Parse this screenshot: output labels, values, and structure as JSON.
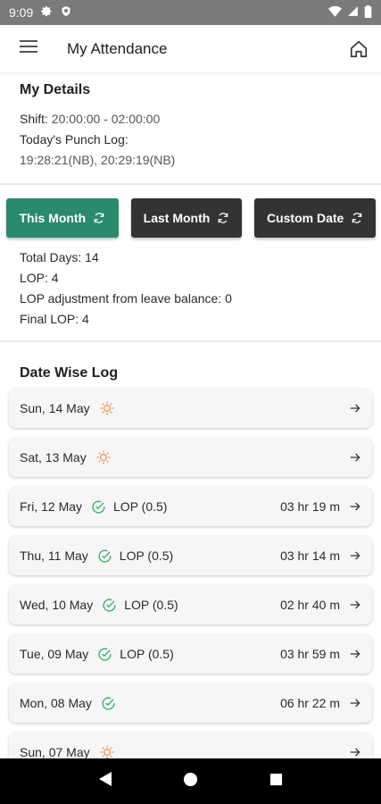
{
  "status_bar": {
    "time": "9:09"
  },
  "app_bar": {
    "title": "My Attendance"
  },
  "details": {
    "title": "My Details",
    "shift_label": "Shift:",
    "shift_value": "20:00:00 - 02:00:00",
    "punch_label": "Today's Punch Log:",
    "punch_value": "19:28:21(NB), 20:29:19(NB)"
  },
  "filters": [
    {
      "label": "This Month",
      "active": true
    },
    {
      "label": "Last Month",
      "active": false
    },
    {
      "label": "Custom Date",
      "active": false
    }
  ],
  "summary": {
    "total_days": "Total Days: 14",
    "lop": "LOP: 4",
    "lop_adjustment": "LOP adjustment from leave balance: 0",
    "final_lop": "Final LOP: 4"
  },
  "log": {
    "title": "Date Wise Log",
    "entries": [
      {
        "date": "Sun, 14 May",
        "icon": "sun-icon",
        "status": "",
        "hours": ""
      },
      {
        "date": "Sat, 13 May",
        "icon": "sun-icon",
        "status": "",
        "hours": ""
      },
      {
        "date": "Fri, 12 May",
        "icon": "check-circle-icon",
        "status": "LOP (0.5)",
        "hours": "03 hr  19 m"
      },
      {
        "date": "Thu, 11 May",
        "icon": "check-circle-icon",
        "status": "LOP (0.5)",
        "hours": "03 hr  14 m"
      },
      {
        "date": "Wed, 10 May",
        "icon": "check-circle-icon",
        "status": "LOP (0.5)",
        "hours": "02 hr  40 m"
      },
      {
        "date": "Tue, 09 May",
        "icon": "check-circle-icon",
        "status": "LOP (0.5)",
        "hours": "03 hr  59 m"
      },
      {
        "date": "Mon, 08 May",
        "icon": "check-circle-icon",
        "status": "",
        "hours": "06 hr  22 m"
      },
      {
        "date": "Sun, 07 May",
        "icon": "sun-icon",
        "status": "",
        "hours": ""
      }
    ]
  },
  "colors": {
    "accent": "#2a8a6e",
    "dark_button": "#333333",
    "sun": "#f08a3c",
    "check": "#3cb371"
  }
}
